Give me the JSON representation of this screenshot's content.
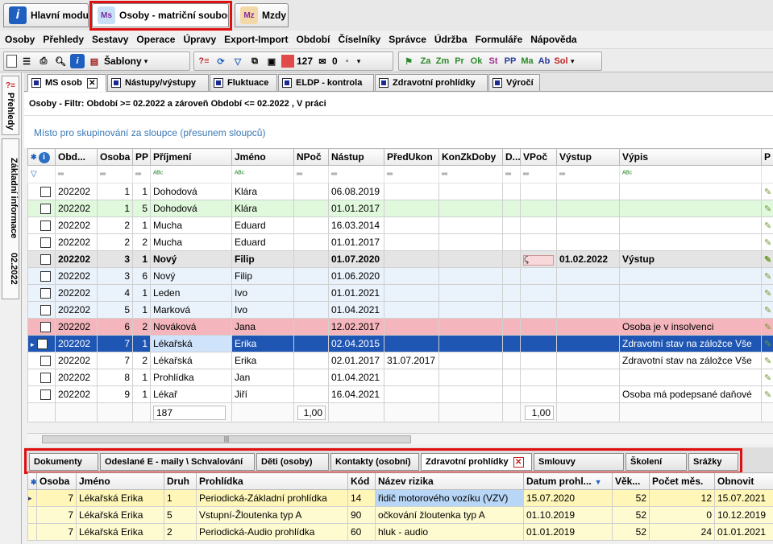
{
  "module_tabs": [
    {
      "label": "Hlavní modul",
      "icon": "info-icon"
    },
    {
      "label": "Osoby - matriční soubor",
      "icon": "ms-icon"
    },
    {
      "label": "Mzdy",
      "icon": "mzdy-icon"
    }
  ],
  "menu": [
    "Osoby",
    "Přehledy",
    "Sestavy",
    "Operace",
    "Úpravy",
    "Export-Import",
    "Období",
    "Číselníky",
    "Správce",
    "Údržba",
    "Formuláře",
    "Nápověda"
  ],
  "toolbar": {
    "templates_label": "Šablony",
    "count_value": "127",
    "mail_count": "0"
  },
  "sidebar_tabs": [
    "Přehledy",
    "Základní informace",
    "02.2022"
  ],
  "doc_tabs": [
    "MS osob",
    "Nástupy/výstupy",
    "Fluktuace",
    "ELDP - kontrola",
    "Zdravotní prohlídky",
    "Výročí"
  ],
  "filter_text": "Osoby - Filtr: Období >= 02.2022 a zároveň Období <= 02.2022 , V práci",
  "group_hint": "Místo pro skupinování za sloupce (přesunem sloupců)",
  "grid": {
    "columns": [
      "",
      "Obd...",
      "Osoba",
      "PP",
      "Příjmení",
      "Jméno",
      "NPoč",
      "Nástup",
      "PředUkon",
      "KonZkDoby",
      "D...",
      "VPoč",
      "Výstup",
      "Výpis",
      "P"
    ],
    "rows": [
      {
        "style": "white",
        "obd": "202202",
        "osoba": "1",
        "pp": "1",
        "prijmeni": "Dohodová",
        "jmeno": "Klára",
        "nastup": "06.08.2019",
        "preduk": "",
        "vystup": "",
        "vypis": ""
      },
      {
        "style": "green",
        "obd": "202202",
        "osoba": "1",
        "pp": "5",
        "prijmeni": "Dohodová",
        "jmeno": "Klára",
        "nastup": "01.01.2017",
        "preduk": "",
        "vystup": "",
        "vypis": ""
      },
      {
        "style": "white",
        "obd": "202202",
        "osoba": "2",
        "pp": "1",
        "prijmeni": "Mucha",
        "jmeno": "Eduard",
        "nastup": "16.03.2014",
        "preduk": "",
        "vystup": "",
        "vypis": ""
      },
      {
        "style": "white",
        "obd": "202202",
        "osoba": "2",
        "pp": "2",
        "prijmeni": "Mucha",
        "jmeno": "Eduard",
        "nastup": "01.01.2017",
        "preduk": "",
        "vystup": "",
        "vypis": ""
      },
      {
        "style": "gray",
        "obd": "202202",
        "osoba": "3",
        "pp": "1",
        "prijmeni": "Nový",
        "jmeno": "Filip",
        "nastup": "01.07.2020",
        "preduk": "",
        "vystup": "01.02.2022",
        "vypis": "Výstup"
      },
      {
        "style": "blue",
        "obd": "202202",
        "osoba": "3",
        "pp": "6",
        "prijmeni": "Nový",
        "jmeno": "Filip",
        "nastup": "01.06.2020",
        "preduk": "",
        "vystup": "",
        "vypis": ""
      },
      {
        "style": "blue",
        "obd": "202202",
        "osoba": "4",
        "pp": "1",
        "prijmeni": "Leden",
        "jmeno": "Ivo",
        "nastup": "01.01.2021",
        "preduk": "",
        "vystup": "",
        "vypis": ""
      },
      {
        "style": "blue",
        "obd": "202202",
        "osoba": "5",
        "pp": "1",
        "prijmeni": "Marková",
        "jmeno": "Ivo",
        "nastup": "01.04.2021",
        "preduk": "",
        "vystup": "",
        "vypis": ""
      },
      {
        "style": "red",
        "obd": "202202",
        "osoba": "6",
        "pp": "2",
        "prijmeni": "Nováková",
        "jmeno": "Jana",
        "nastup": "12.02.2017",
        "preduk": "",
        "vystup": "",
        "vypis": "Osoba je v insolvenci"
      },
      {
        "style": "sel",
        "obd": "202202",
        "osoba": "7",
        "pp": "1",
        "prijmeni": "Lékařská",
        "jmeno": "Erika",
        "nastup": "02.04.2015",
        "preduk": "",
        "vystup": "",
        "vypis": "Zdravotní stav na záložce Vše"
      },
      {
        "style": "white",
        "obd": "202202",
        "osoba": "7",
        "pp": "2",
        "prijmeni": "Lékařská",
        "jmeno": "Erika",
        "nastup": "02.01.2017",
        "preduk": "31.07.2017",
        "vystup": "",
        "vypis": "Zdravotní stav na záložce Vše"
      },
      {
        "style": "white",
        "obd": "202202",
        "osoba": "8",
        "pp": "1",
        "prijmeni": "Prohlídka",
        "jmeno": "Jan",
        "nastup": "01.04.2021",
        "preduk": "",
        "vystup": "",
        "vypis": ""
      },
      {
        "style": "white",
        "obd": "202202",
        "osoba": "9",
        "pp": "1",
        "prijmeni": "Lékař",
        "jmeno": "Jiří",
        "nastup": "16.04.2021",
        "preduk": "",
        "vystup": "",
        "vypis": "Osoba má podepsané daňové"
      }
    ],
    "summary": {
      "count": "187",
      "npoc": "1,00",
      "vpoc": "1,00"
    }
  },
  "bottom_tabs": [
    "Dokumenty",
    "Odeslané E - maily \\ Schvalování",
    "Děti (osoby)",
    "Kontakty (osobní)",
    "Zdravotní prohlídky",
    "Smlouvy",
    "Školení",
    "Srážky"
  ],
  "exams": {
    "columns": [
      "",
      "Osoba",
      "Jméno",
      "Druh",
      "Prohlídka",
      "Kód",
      "Název rizika",
      "Datum prohl...",
      "Věk...",
      "Počet měs.",
      "Obnovit"
    ],
    "rows": [
      {
        "osoba": "7",
        "jmeno": "Lékařská Erika",
        "druh": "1",
        "prohlidka": "Periodická-Základní prohlídka",
        "kod": "14",
        "riziko": "řidič motorového vozíku (VZV)",
        "datum": "15.07.2020",
        "vek": "52",
        "pocet": "12",
        "obnovit": "15.07.2021"
      },
      {
        "osoba": "7",
        "jmeno": "Lékařská Erika",
        "druh": "5",
        "prohlidka": "Vstupní-Žloutenka typ A",
        "kod": "90",
        "riziko": "očkování žloutenka typ A",
        "datum": "01.10.2019",
        "vek": "52",
        "pocet": "0",
        "obnovit": "10.12.2019"
      },
      {
        "osoba": "7",
        "jmeno": "Lékařská Erika",
        "druh": "2",
        "prohlidka": "Periodická-Audio prohlídka",
        "kod": "60",
        "riziko": "hluk - audio",
        "datum": "01.01.2019",
        "vek": "52",
        "pocet": "24",
        "obnovit": "01.01.2021"
      }
    ]
  }
}
